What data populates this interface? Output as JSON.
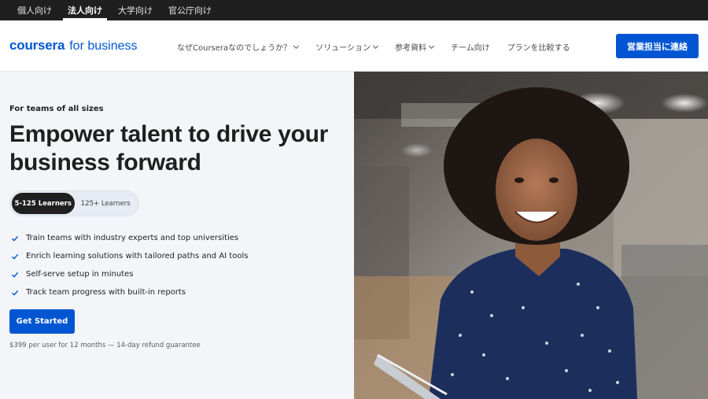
{
  "topbar": {
    "audiences": [
      {
        "label": "個人向け",
        "active": false
      },
      {
        "label": "法人向け",
        "active": true
      },
      {
        "label": "大学向け",
        "active": false
      },
      {
        "label": "官公庁向け",
        "active": false
      }
    ]
  },
  "header": {
    "brand": "coursera",
    "brand_sub": "for business",
    "nav": [
      {
        "label": "なぜCourseraなのでしょうか？",
        "dropdown": true
      },
      {
        "label": "ソリューション",
        "dropdown": true
      },
      {
        "label": "参考資料",
        "dropdown": true
      },
      {
        "label": "チーム向け",
        "dropdown": false
      },
      {
        "label": "プランを比較する",
        "dropdown": false
      }
    ],
    "contact_label": "営業担当に連絡"
  },
  "hero": {
    "eyebrow": "For teams of all sizes",
    "title": "Empower talent to drive your business forward",
    "toggle": {
      "options": [
        "5-125 Learners",
        "125+ Learners"
      ],
      "selected": "5-125 Learners"
    },
    "features": [
      "Train teams with industry experts and top universities",
      "Enrich learning solutions with tailored paths and AI tools",
      "Self-serve setup in minutes",
      "Track team progress with built-in reports"
    ],
    "cta_label": "Get Started",
    "price_note": "$399 per user for 12 months — 14-day refund guarantee"
  },
  "colors": {
    "brand_blue": "#0056d2",
    "topbar_bg": "#1f1f1f",
    "hero_bg": "#f3f5f9"
  },
  "icons": [
    "check-icon",
    "chevron-down-icon"
  ]
}
